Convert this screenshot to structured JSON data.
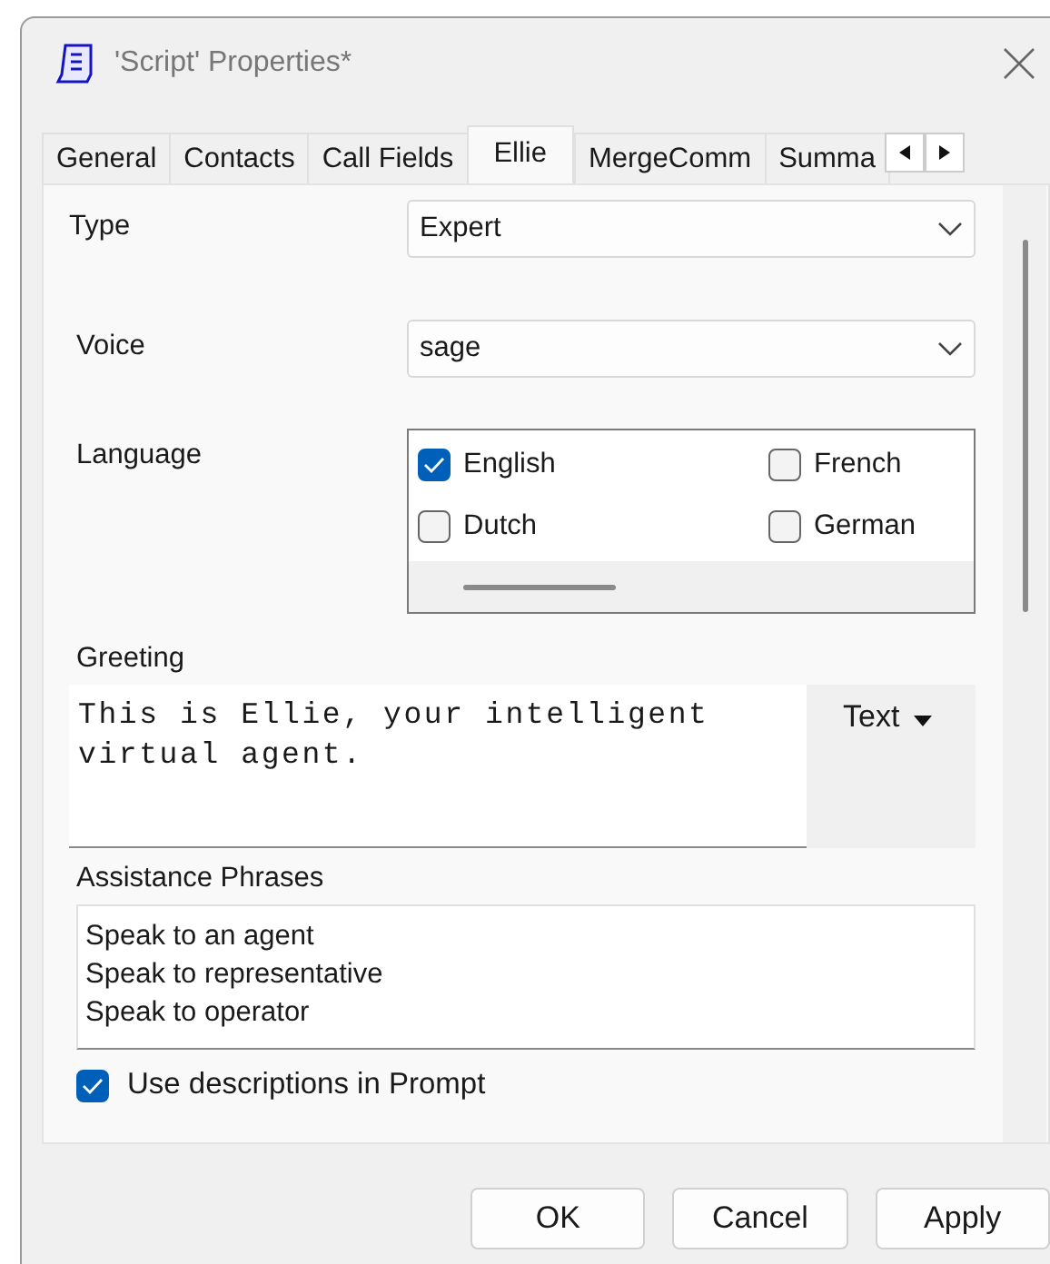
{
  "window": {
    "title": "'Script' Properties*"
  },
  "tabs": [
    {
      "label": "General",
      "selected": false
    },
    {
      "label": "Contacts",
      "selected": false
    },
    {
      "label": "Call Fields",
      "selected": false
    },
    {
      "label": "Ellie",
      "selected": true
    },
    {
      "label": "MergeComm",
      "selected": false
    },
    {
      "label": "Summa",
      "selected": false
    }
  ],
  "type": {
    "label": "Type",
    "value": "Expert"
  },
  "voice": {
    "label": "Voice",
    "value": "sage"
  },
  "language": {
    "label": "Language",
    "options": [
      {
        "label": "English",
        "checked": true
      },
      {
        "label": "French",
        "checked": false
      },
      {
        "label": "Dutch",
        "checked": false
      },
      {
        "label": "German",
        "checked": false
      }
    ]
  },
  "greeting": {
    "label": "Greeting",
    "value": "This is Ellie, your intelligent virtual agent.",
    "format": "Text"
  },
  "assistance_phrases": {
    "label": "Assistance Phrases",
    "lines": [
      "Speak to an agent",
      "Speak to representative",
      "Speak to operator"
    ]
  },
  "use_descriptions": {
    "label": "Use descriptions in Prompt",
    "checked": true
  },
  "buttons": [
    "OK",
    "Cancel",
    "Apply"
  ]
}
